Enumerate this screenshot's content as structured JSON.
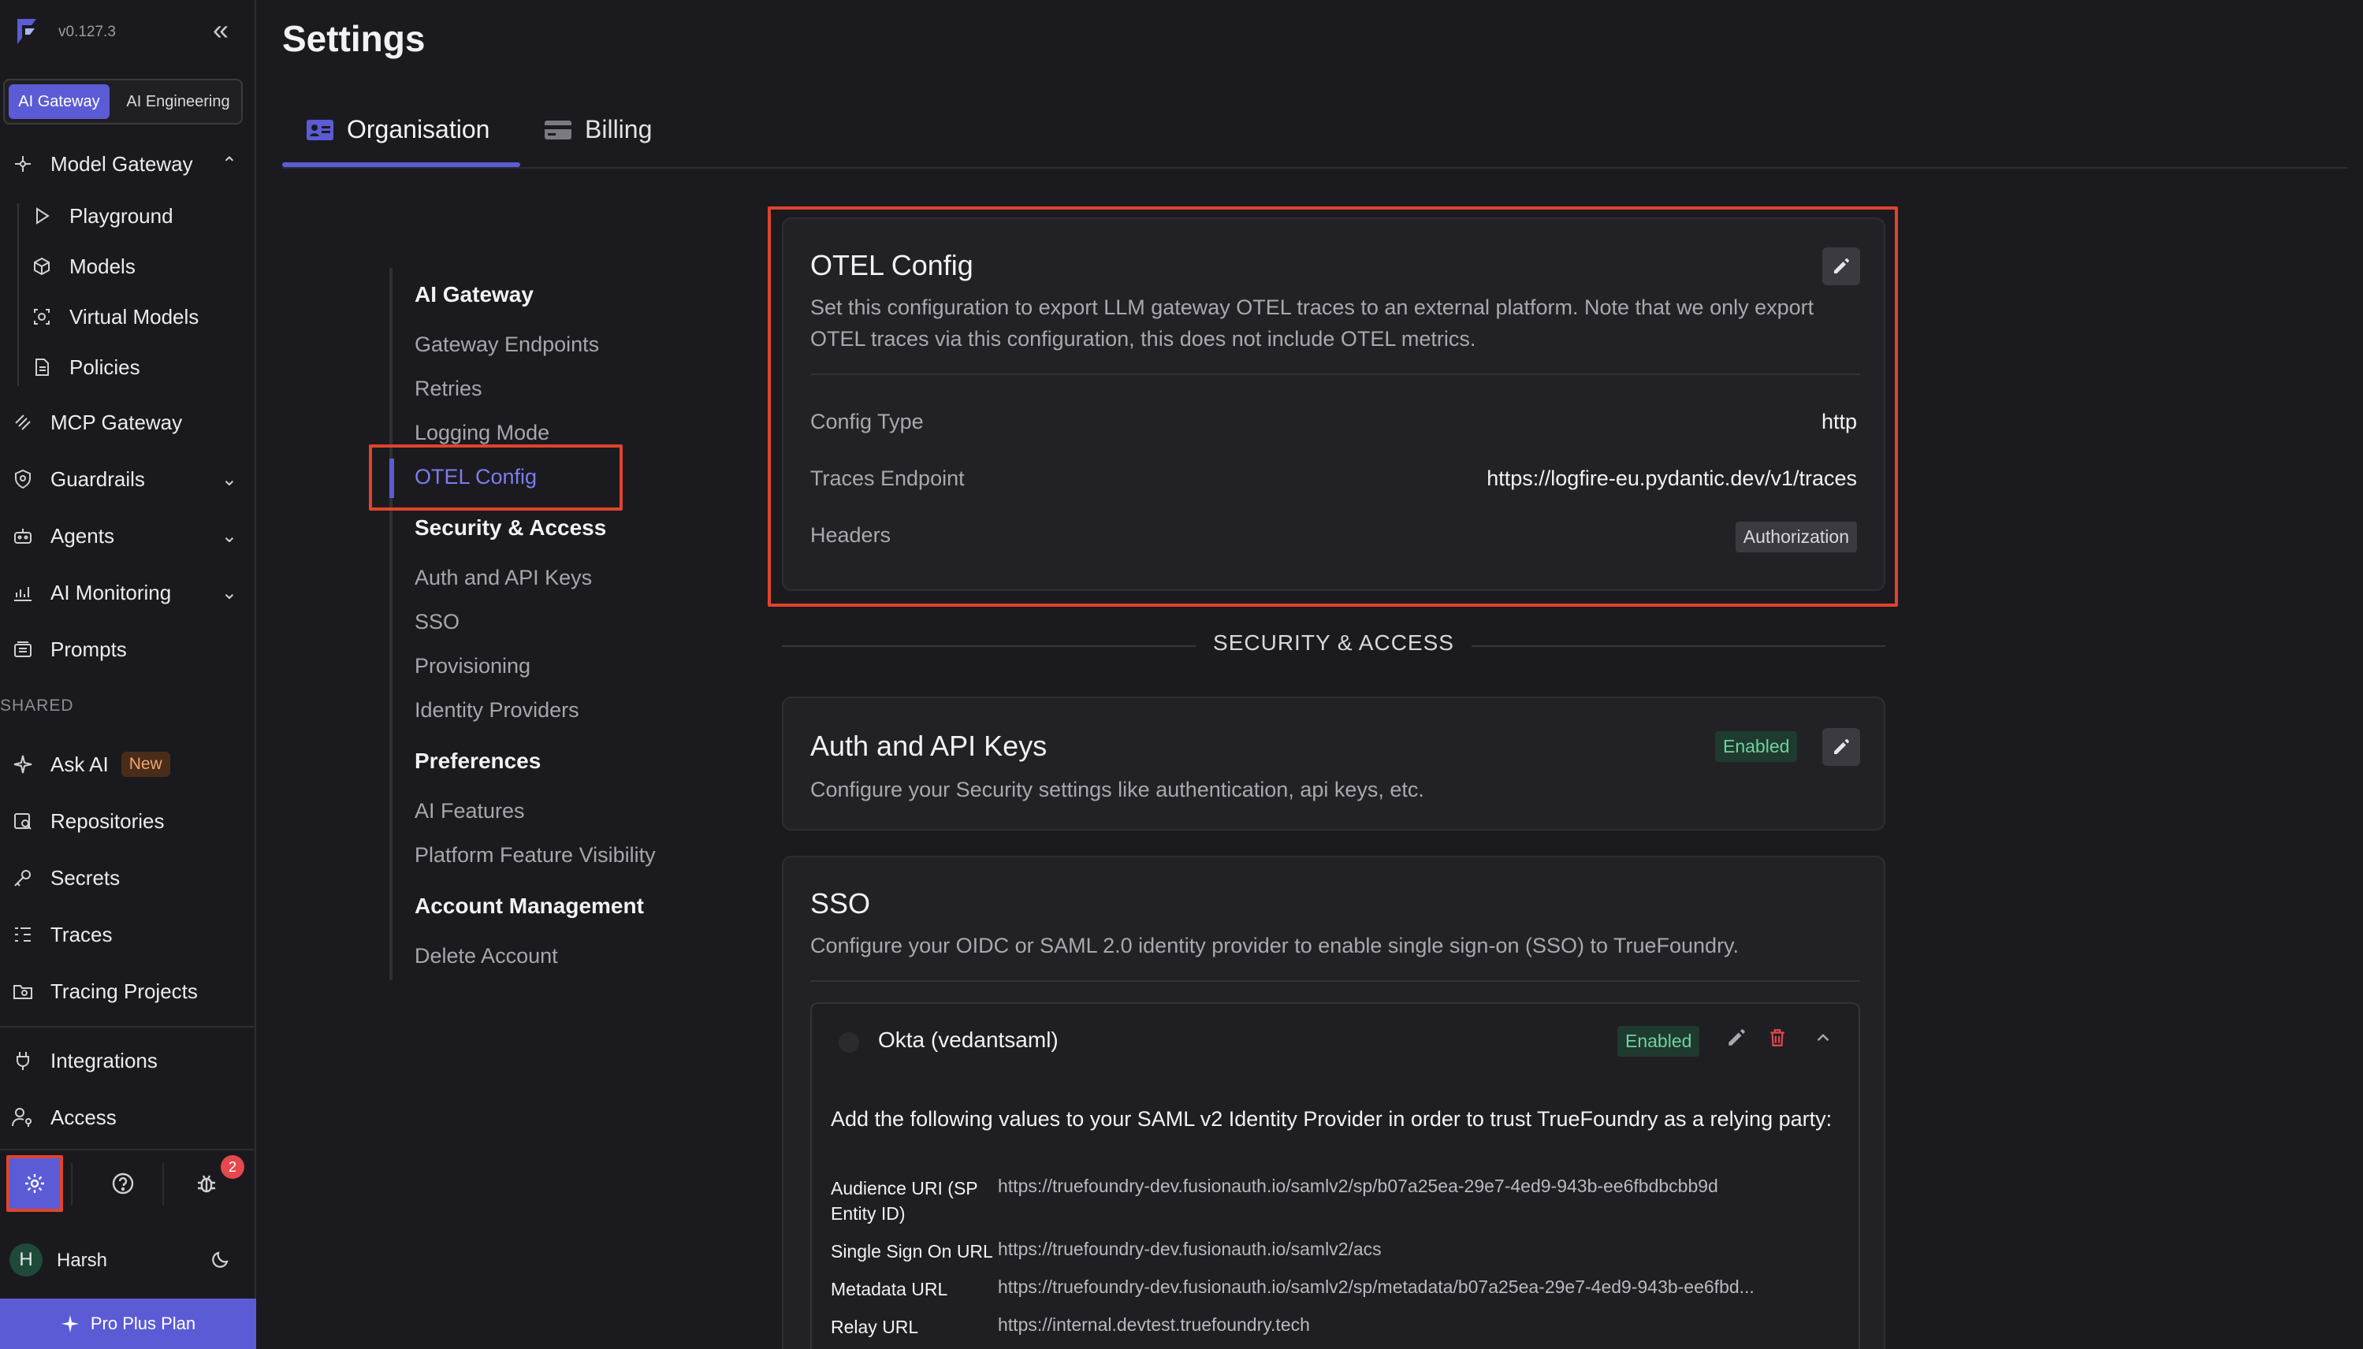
{
  "app": {
    "version": "v0.127.3",
    "mode_tabs": [
      "AI Gateway",
      "AI Engineering"
    ]
  },
  "sidebar": {
    "items": [
      {
        "label": "Model Gateway",
        "icon": "model-gateway-icon"
      },
      {
        "label": "Playground",
        "icon": "play-icon"
      },
      {
        "label": "Models",
        "icon": "cube-icon"
      },
      {
        "label": "Virtual Models",
        "icon": "virtual-model-icon"
      },
      {
        "label": "Policies",
        "icon": "document-icon"
      },
      {
        "label": "MCP Gateway",
        "icon": "mcp-icon"
      },
      {
        "label": "Guardrails",
        "icon": "shield-icon"
      },
      {
        "label": "Agents",
        "icon": "robot-icon"
      },
      {
        "label": "AI Monitoring",
        "icon": "chart-icon"
      },
      {
        "label": "Prompts",
        "icon": "prompts-icon"
      }
    ],
    "shared_label": "SHARED",
    "shared_items": [
      {
        "label": "Ask AI",
        "badge": "New",
        "icon": "sparkle-icon"
      },
      {
        "label": "Repositories",
        "icon": "repository-icon"
      },
      {
        "label": "Secrets",
        "icon": "key-icon"
      },
      {
        "label": "Traces",
        "icon": "traces-icon"
      },
      {
        "label": "Tracing Projects",
        "icon": "folder-icon"
      }
    ],
    "bottom_items": [
      {
        "label": "Integrations",
        "icon": "plug-icon"
      },
      {
        "label": "Access",
        "icon": "user-key-icon"
      }
    ],
    "notification_count": "2",
    "user": {
      "initial": "H",
      "name": "Harsh"
    },
    "plan_label": "Pro Plus Plan"
  },
  "page": {
    "title": "Settings",
    "tabs": [
      "Organisation",
      "Billing"
    ]
  },
  "settings_nav": {
    "ai_gateway": "AI Gateway",
    "gateway_endpoints": "Gateway Endpoints",
    "retries": "Retries",
    "logging_mode": "Logging Mode",
    "otel_config": "OTEL Config",
    "security_access": "Security & Access",
    "auth_api_keys": "Auth and API Keys",
    "sso": "SSO",
    "provisioning": "Provisioning",
    "identity_providers": "Identity Providers",
    "preferences": "Preferences",
    "ai_features": "AI Features",
    "platform_feature_visibility": "Platform Feature Visibility",
    "account_management": "Account Management",
    "delete_account": "Delete Account"
  },
  "otel": {
    "title": "OTEL Config",
    "description": "Set this configuration to export LLM gateway OTEL traces to an external platform. Note that we only export OTEL traces via this configuration, this does not include OTEL metrics.",
    "config_type_label": "Config Type",
    "config_type_value": "http",
    "traces_endpoint_label": "Traces Endpoint",
    "traces_endpoint_value": "https://logfire-eu.pydantic.dev/v1/traces",
    "headers_label": "Headers",
    "headers_value": "Authorization"
  },
  "section_divider": "SECURITY & ACCESS",
  "auth": {
    "title": "Auth and API Keys",
    "status": "Enabled",
    "description": "Configure your Security settings like authentication, api keys, etc."
  },
  "sso": {
    "title": "SSO",
    "description": "Configure your OIDC or SAML 2.0 identity provider to enable single sign-on (SSO) to TrueFoundry.",
    "provider_name": "Okta (vedantsaml)",
    "provider_status": "Enabled",
    "instructions": "Add the following values to your SAML v2 Identity Provider in order to trust TrueFoundry as a relying party:",
    "fields": [
      {
        "label": "Audience URI (SP Entity ID)",
        "value": "https://truefoundry-dev.fusionauth.io/samlv2/sp/b07a25ea-29e7-4ed9-943b-ee6fbdbcbb9d"
      },
      {
        "label": "Single Sign On URL",
        "value": "https://truefoundry-dev.fusionauth.io/samlv2/acs"
      },
      {
        "label": "Metadata URL",
        "value": "https://truefoundry-dev.fusionauth.io/samlv2/sp/metadata/b07a25ea-29e7-4ed9-943b-ee6fbd..."
      },
      {
        "label": "Relay URL",
        "value": "https://internal.devtest.truefoundry.tech"
      }
    ]
  },
  "colors": {
    "accent": "#5b5bd6",
    "highlight": "#e0442c",
    "enabled_text": "#6fd19f"
  }
}
